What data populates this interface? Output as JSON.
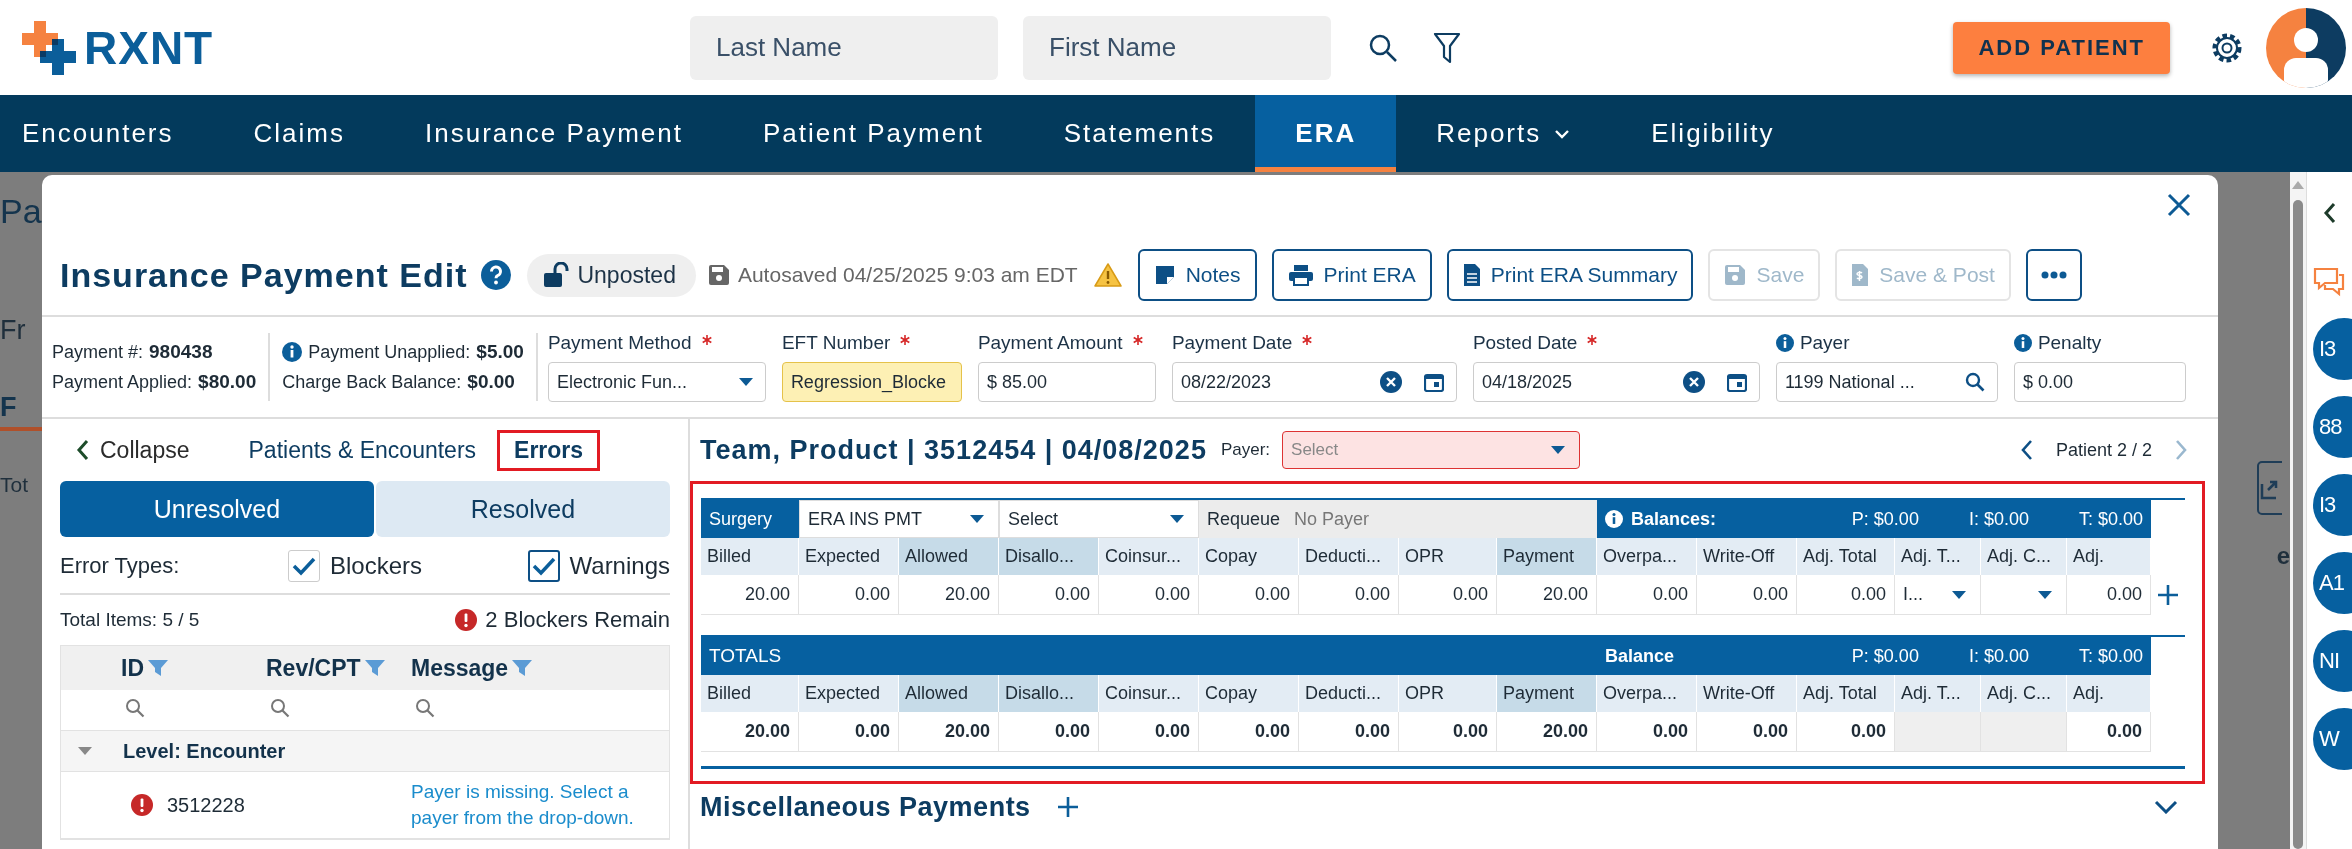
{
  "header": {
    "logo": "RXNT",
    "search_fields": [
      {
        "placeholder": "Last Name"
      },
      {
        "placeholder": "First Name"
      }
    ],
    "add_button": "ADD PATIENT"
  },
  "nav": [
    {
      "label": "Encounters",
      "selected": false,
      "has_menu": false
    },
    {
      "label": "Claims",
      "selected": false,
      "has_menu": false
    },
    {
      "label": "Insurance Payment",
      "selected": false,
      "has_menu": false
    },
    {
      "label": "Patient Payment",
      "selected": false,
      "has_menu": false
    },
    {
      "label": "Statements",
      "selected": false,
      "has_menu": false
    },
    {
      "label": "ERA",
      "selected": true,
      "has_menu": false
    },
    {
      "label": "Reports",
      "selected": false,
      "has_menu": true
    },
    {
      "label": "Eligibility",
      "selected": false,
      "has_menu": false
    }
  ],
  "background_page": {
    "title": "Pa",
    "filter_label": "Fr",
    "tab": "F",
    "total": "Tot",
    "side_text": "e"
  },
  "modal": {
    "title": "Insurance Payment Edit",
    "status": {
      "label": "Unposted"
    },
    "autosaved": "Autosaved 04/25/2025 9:03 am EDT",
    "actions": [
      {
        "label": "Notes",
        "kind": "note",
        "disabled": false
      },
      {
        "label": "Print ERA",
        "kind": "print",
        "disabled": false
      },
      {
        "label": "Print ERA Summary",
        "kind": "document",
        "disabled": false
      },
      {
        "label": "Save",
        "kind": "save",
        "disabled": true
      },
      {
        "label": "Save & Post",
        "kind": "receipt",
        "disabled": true
      }
    ],
    "summary": [
      [
        {
          "label": "Payment #:",
          "value": "980438",
          "info": false
        },
        {
          "label": "Payment Applied:",
          "value": "$80.00",
          "info": false
        }
      ],
      [
        {
          "label": "Payment Unapplied:",
          "value": "$5.00",
          "info": true
        },
        {
          "label": "Charge Back Balance:",
          "value": "$0.00",
          "info": false
        }
      ]
    ],
    "fields": [
      {
        "label": "Payment Method",
        "required": true,
        "info": false,
        "kind": "dropdown",
        "value": "Electronic Fun...",
        "highlighted": false
      },
      {
        "label": "EFT Number",
        "required": true,
        "info": false,
        "kind": "text",
        "value": "Regression_Blocke",
        "highlighted": true
      },
      {
        "label": "Payment Amount",
        "required": true,
        "info": false,
        "kind": "text",
        "value": "$ 85.00",
        "highlighted": false
      },
      {
        "label": "Payment Date",
        "required": true,
        "info": false,
        "kind": "date",
        "value": "08/22/2023",
        "highlighted": false
      },
      {
        "label": "Posted Date",
        "required": true,
        "info": false,
        "kind": "date",
        "value": "04/18/2025",
        "highlighted": false
      },
      {
        "label": "Payer",
        "required": false,
        "info": true,
        "kind": "search",
        "value": "1199 National ...",
        "highlighted": false
      },
      {
        "label": "Penalty",
        "required": false,
        "info": true,
        "kind": "text",
        "value": "$ 0.00",
        "highlighted": false
      }
    ],
    "errors_panel": {
      "collapse": "Collapse",
      "tabs": [
        {
          "label": "Patients & Encounters",
          "selected": false
        },
        {
          "label": "Errors",
          "selected": true
        }
      ],
      "segments": [
        {
          "label": "Unresolved",
          "selected": true
        },
        {
          "label": "Resolved",
          "selected": false
        }
      ],
      "error_types_label": "Error Types:",
      "filters": [
        {
          "label": "Blockers",
          "checked": true
        },
        {
          "label": "Warnings",
          "checked": true
        }
      ],
      "total_items": "Total Items: 5 / 5",
      "blockers_remain": "2 Blockers Remain",
      "columns": [
        "ID",
        "Rev/CPT",
        "Message"
      ],
      "groups": [
        {
          "label": "Level: Encounter",
          "expanded": true,
          "rows": [
            {
              "id": "3512228",
              "kind": "blocker",
              "message": "Payer is missing. Select a payer from the drop-down."
            }
          ]
        }
      ]
    },
    "encounter": {
      "title": "Team, Product | 3512454 | 04/08/2025",
      "payer": {
        "label": "Payer:",
        "placeholder": "Select",
        "invalid": true
      },
      "pager": {
        "text": "Patient 2 / 2",
        "prev_disabled": false,
        "next_disabled": true
      },
      "line": {
        "procedure": "Surgery",
        "adjustment": "ERA INS PMT",
        "select": "Select",
        "requeue_label": "Requeue",
        "requeue_value": "No Payer",
        "balances_label": "Balances:",
        "balances": [
          "P: $0.00",
          "I: $0.00",
          "T: $0.00"
        ],
        "columns": [
          {
            "label": "Billed",
            "highlighted": false
          },
          {
            "label": "Expected",
            "highlighted": false
          },
          {
            "label": "Allowed",
            "highlighted": true
          },
          {
            "label": "Disallo...",
            "highlighted": true
          },
          {
            "label": "Coinsur...",
            "highlighted": false
          },
          {
            "label": "Copay",
            "highlighted": false
          },
          {
            "label": "Deducti...",
            "highlighted": false
          },
          {
            "label": "OPR",
            "highlighted": false
          },
          {
            "label": "Payment",
            "highlighted": true
          },
          {
            "label": "Overpa...",
            "highlighted": false
          },
          {
            "label": "Write-Off",
            "highlighted": false
          },
          {
            "label": "Adj. Total",
            "highlighted": false
          },
          {
            "label": "Adj. T...",
            "highlighted": false
          },
          {
            "label": "Adj. C...",
            "highlighted": false
          },
          {
            "label": "Adj.",
            "highlighted": false
          }
        ],
        "values": [
          {
            "kind": "number",
            "text": "20.00"
          },
          {
            "kind": "number",
            "text": "0.00"
          },
          {
            "kind": "number",
            "text": "20.00"
          },
          {
            "kind": "number",
            "text": "0.00"
          },
          {
            "kind": "number",
            "text": "0.00"
          },
          {
            "kind": "number",
            "text": "0.00"
          },
          {
            "kind": "number",
            "text": "0.00"
          },
          {
            "kind": "number",
            "text": "0.00"
          },
          {
            "kind": "number",
            "text": "20.00"
          },
          {
            "kind": "number",
            "text": "0.00"
          },
          {
            "kind": "number",
            "text": "0.00"
          },
          {
            "kind": "number",
            "text": "0.00"
          },
          {
            "kind": "select",
            "text": "I..."
          },
          {
            "kind": "select"
          },
          {
            "kind": "number",
            "text": "0.00"
          }
        ]
      },
      "totals": {
        "title": "TOTALS",
        "balance_label": "Balance",
        "balances": [
          "P: $0.00",
          "I: $0.00",
          "T: $0.00"
        ],
        "columns": [
          {
            "label": "Billed",
            "highlighted": false
          },
          {
            "label": "Expected",
            "highlighted": false
          },
          {
            "label": "Allowed",
            "highlighted": true
          },
          {
            "label": "Disallo...",
            "highlighted": true
          },
          {
            "label": "Coinsur...",
            "highlighted": false
          },
          {
            "label": "Copay",
            "highlighted": false
          },
          {
            "label": "Deducti...",
            "highlighted": false
          },
          {
            "label": "OPR",
            "highlighted": false
          },
          {
            "label": "Payment",
            "highlighted": true
          },
          {
            "label": "Overpa...",
            "highlighted": false
          },
          {
            "label": "Write-Off",
            "highlighted": false
          },
          {
            "label": "Adj. Total",
            "highlighted": false
          },
          {
            "label": "Adj. T...",
            "highlighted": false
          },
          {
            "label": "Adj. C...",
            "highlighted": false
          },
          {
            "label": "Adj.",
            "highlighted": false
          }
        ],
        "values": [
          {
            "kind": "number",
            "text": "20.00"
          },
          {
            "kind": "number",
            "text": "0.00"
          },
          {
            "kind": "number",
            "text": "20.00"
          },
          {
            "kind": "number",
            "text": "0.00"
          },
          {
            "kind": "number",
            "text": "0.00"
          },
          {
            "kind": "number",
            "text": "0.00"
          },
          {
            "kind": "number",
            "text": "0.00"
          },
          {
            "kind": "number",
            "text": "0.00"
          },
          {
            "kind": "number",
            "text": "20.00"
          },
          {
            "kind": "number",
            "text": "0.00"
          },
          {
            "kind": "number",
            "text": "0.00"
          },
          {
            "kind": "number",
            "text": "0.00"
          },
          {
            "kind": "empty"
          },
          {
            "kind": "empty"
          },
          {
            "kind": "number",
            "text": "0.00"
          }
        ]
      },
      "misc_title": "Miscellaneous Payments"
    }
  },
  "right_rail": {
    "badges": [
      {
        "text": "I3"
      },
      {
        "text": "88"
      },
      {
        "text": "I3"
      },
      {
        "text": "A1"
      },
      {
        "text": "NI"
      },
      {
        "text": "W"
      }
    ]
  }
}
